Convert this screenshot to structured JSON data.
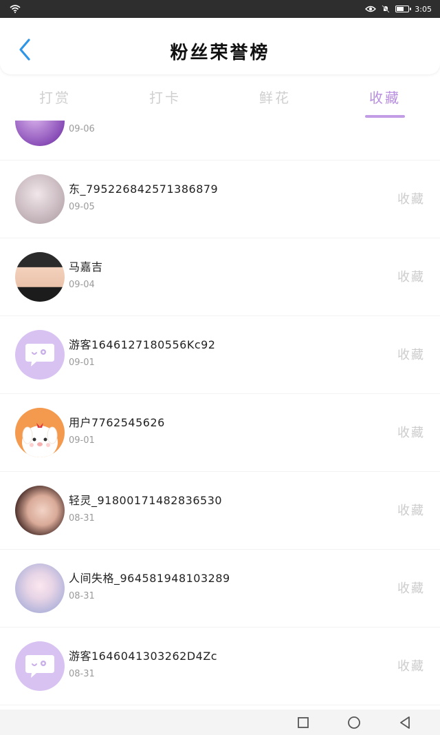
{
  "status_bar": {
    "time": "3:05"
  },
  "header": {
    "title": "粉丝荣誉榜",
    "back_icon": "chevron-left-icon"
  },
  "tabs": [
    {
      "label": "打赏",
      "active": false
    },
    {
      "label": "打卡",
      "active": false
    },
    {
      "label": "鲜花",
      "active": false
    },
    {
      "label": "收藏",
      "active": true
    }
  ],
  "list": {
    "action_label": "收藏",
    "items": [
      {
        "name": "",
        "date": "09-06",
        "avatar": "photo-avatar",
        "show_action": false
      },
      {
        "name": "东_795226842571386879",
        "date": "09-05",
        "avatar": "photo-avatar",
        "show_action": true
      },
      {
        "name": "马嘉吉",
        "date": "09-04",
        "avatar": "photo-avatar",
        "show_action": true
      },
      {
        "name": "游客1646127180556Kc92",
        "date": "09-01",
        "avatar": "chat-bubble-avatar",
        "show_action": true
      },
      {
        "name": "用户7762545626",
        "date": "09-01",
        "avatar": "cartoon-dog-avatar",
        "show_action": true
      },
      {
        "name": "轻灵_918001714828365​30",
        "date": "08-31",
        "avatar": "photo-avatar",
        "show_action": true
      },
      {
        "name": "人间失格_964581948103289",
        "date": "08-31",
        "avatar": "anime-avatar",
        "show_action": true
      },
      {
        "name": "游客1646041303262D4Zc",
        "date": "08-31",
        "avatar": "chat-bubble-avatar",
        "show_action": true
      }
    ]
  },
  "colors": {
    "accent": "#b88ee0",
    "back_arrow": "#2f95e6",
    "muted_text": "#cccccc",
    "status_bar": "#2e2e2e"
  }
}
